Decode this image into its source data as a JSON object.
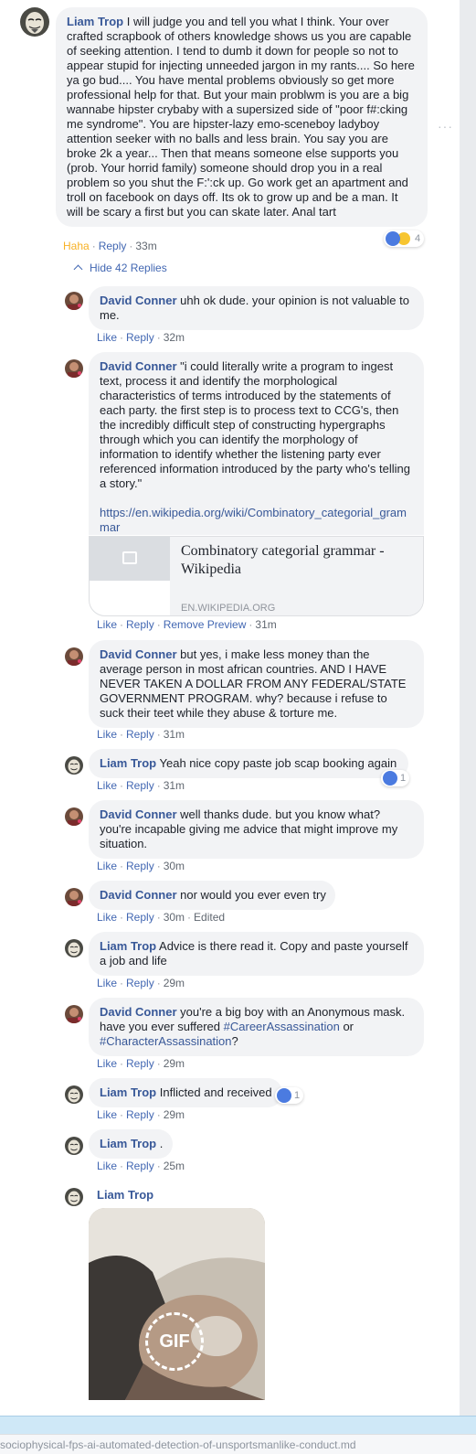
{
  "top_comment": {
    "author": "Liam Trop",
    "text": "I will judge you and tell you what I think. Your over crafted scrapbook of others knowledge shows us you are capable of seeking attention. I tend to dumb it down for people so not to appear stupid for injecting unneeded jargon in my rants.... So here ya go bud.... You have mental problems obviously so get more professional help for that. But your main problwm is you are a big wannabe hipster crybaby with a supersized side of \"poor f#:cking me syndrome\". You are hipster-lazy emo-sceneboy ladyboy attention seeker with no balls and less brain. You say you are broke 2k a year... Then that means someone else supports you (prob. Your horrid family) someone should drop you in a real problem so you shut the F:':ck up. Go work get an apartment and troll on facebook on days off. Its ok to grow up and be a man. It will be scary a first but you can skate later. Anal tart",
    "reaction_label": "Haha",
    "reply_label": "Reply",
    "time": "33m",
    "reaction_count": "4"
  },
  "hide_replies_label": "Hide 42 Replies",
  "more_glyph": "···",
  "replies": [
    {
      "author": "David Conner",
      "text": "uhh ok dude. your opinion is not valuable to me.",
      "like": "Like",
      "reply": "Reply",
      "time": "32m"
    },
    {
      "author": "David Conner",
      "text": "\"i could literally write a program to ingest text, process it and identify the morphological characteristics of terms introduced by the statements of each party. the first step is to process text to CCG's, then the incredibly difficult step of constructing hypergraphs through which you can identify the morphology of information to identify whether the listening party ever referenced information introduced by the party who's telling a story.\"",
      "link": "https://en.wikipedia.org/wiki/Combinatory_categorial_grammar",
      "preview_title": "Combinatory categorial grammar - Wikipedia",
      "preview_domain": "EN.WIKIPEDIA.ORG",
      "like": "Like",
      "reply": "Reply",
      "remove_preview": "Remove Preview",
      "time": "31m"
    },
    {
      "author": "David Conner",
      "text": "but yes, i make less money than the average person in most african countries. AND I HAVE NEVER TAKEN A DOLLAR FROM ANY FEDERAL/STATE GOVERNMENT PROGRAM. why? because i refuse to suck their teet while they abuse & torture me.",
      "like": "Like",
      "reply": "Reply",
      "time": "31m"
    },
    {
      "author": "Liam Trop",
      "text": "Yeah nice copy paste job scap booking again",
      "like": "Like",
      "reply": "Reply",
      "time": "31m",
      "reaction_count": "1"
    },
    {
      "author": "David Conner",
      "text": "well thanks dude. but you know what? you're incapable giving me advice that might improve my situation.",
      "like": "Like",
      "reply": "Reply",
      "time": "30m"
    },
    {
      "author": "David Conner",
      "text": "nor would you ever even try",
      "like": "Like",
      "reply": "Reply",
      "time": "30m",
      "edited": "Edited"
    },
    {
      "author": "Liam Trop",
      "text": "Advice is there read it. Copy and paste yourself a job and life",
      "like": "Like",
      "reply": "Reply",
      "time": "29m"
    },
    {
      "author": "David Conner",
      "text": "you're a big boy with an Anonymous mask. have you ever suffered",
      "hashtag1": "#CareerAssassination",
      "mid": "or",
      "hashtag2": "#CharacterAssassination",
      "tail": "?",
      "like": "Like",
      "reply": "Reply",
      "time": "29m"
    },
    {
      "author": "Liam Trop",
      "text": "Inflicted and received",
      "like": "Like",
      "reply": "Reply",
      "time": "29m",
      "reaction_count": "1"
    },
    {
      "author": "Liam Trop",
      "text": ".",
      "like": "Like",
      "reply": "Reply",
      "time": "25m"
    },
    {
      "author": "Liam Trop",
      "gif_label": "GIF"
    }
  ],
  "url_bar_text": "sociophysical-fps-ai-automated-detection-of-unsportsmanlike-conduct.md",
  "colors": {
    "link": "#385898",
    "bubble": "#f2f3f5",
    "haha": "#f7b125",
    "like_blue": "#4b7be0"
  }
}
